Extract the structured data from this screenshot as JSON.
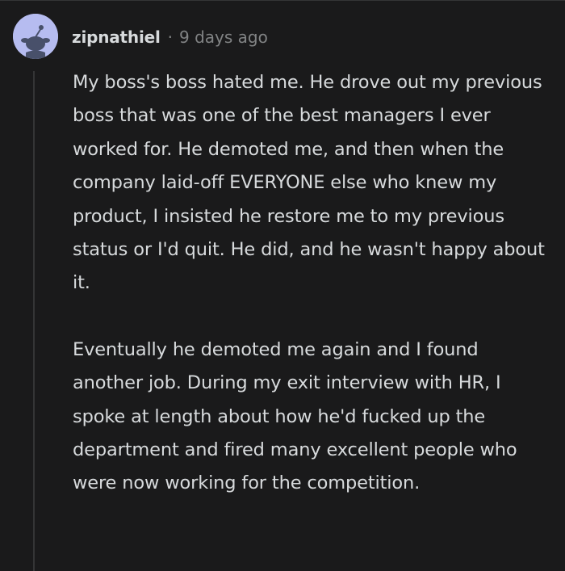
{
  "comment": {
    "author": "zipnathiel",
    "separator": "·",
    "timestamp": "9 days ago",
    "avatar_icon": "reddit-snoo-avatar-icon",
    "paragraphs": [
      "My boss's boss hated me. He drove out my previous boss that was one of the best managers I ever worked for. He demoted me, and then when the company laid-off EVERYONE else who knew my product, I insisted he restore me to my previous status or I'd quit. He did, and he wasn't happy about it.",
      "Eventually he demoted me again and I found another job. During my exit interview with HR, I spoke at length about how he'd fucked up the department and fired many excellent people who were now working for the competition."
    ]
  },
  "colors": {
    "background": "#1a1a1b",
    "text": "#d7dadc",
    "meta": "#818384",
    "thread_line": "#343536",
    "avatar_bg": "#b6bcf0"
  }
}
